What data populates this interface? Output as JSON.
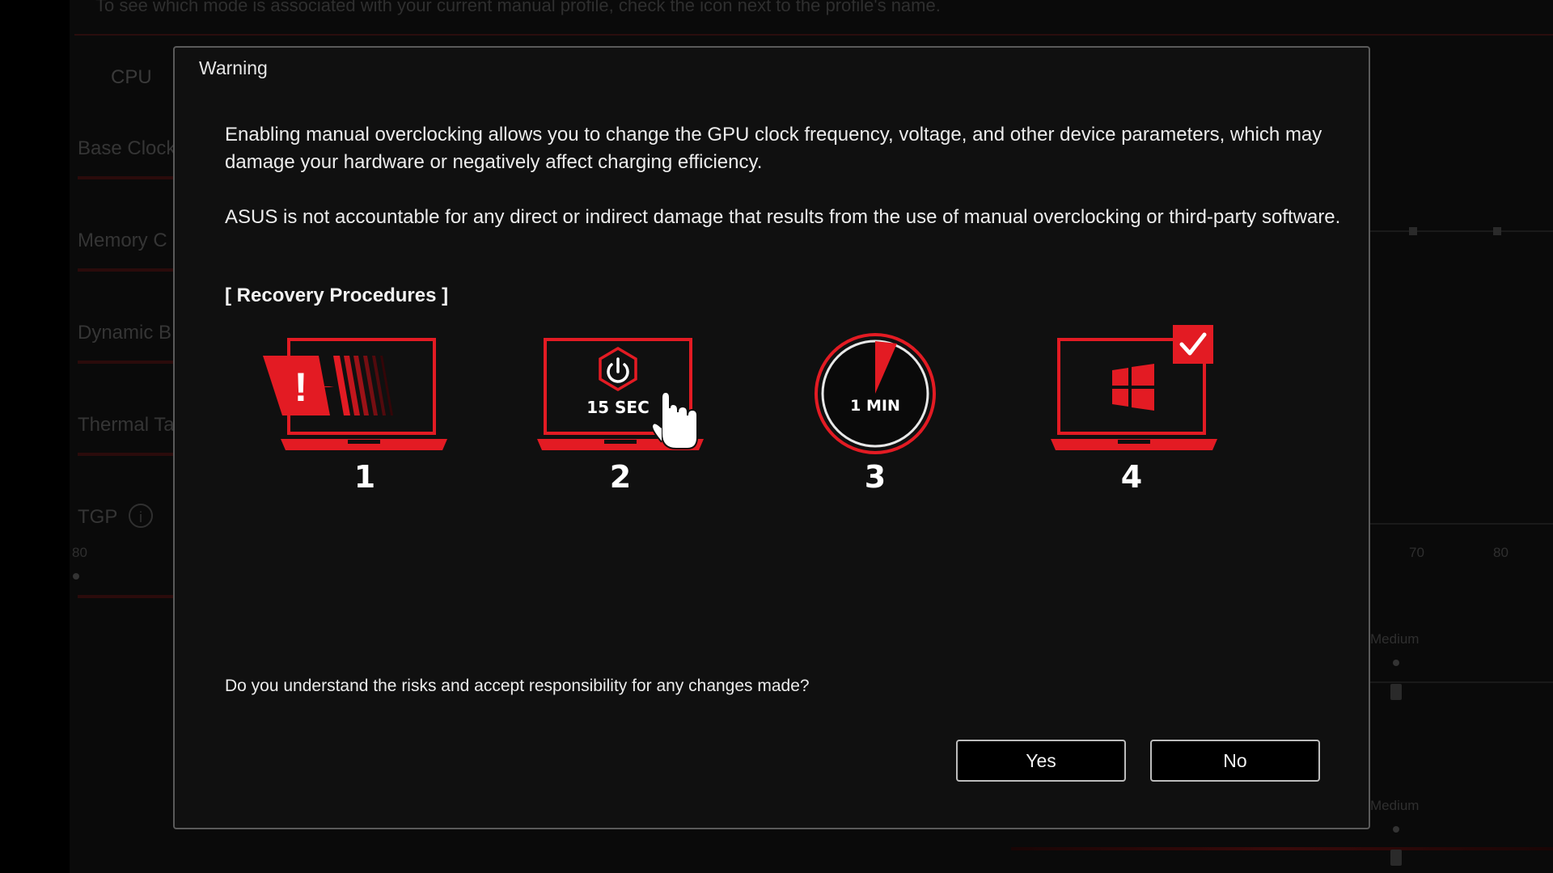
{
  "background": {
    "hint_text": "To see which mode is associated with your current manual profile, check the icon next to the profile's name.",
    "tab_cpu": "CPU",
    "labels": [
      "Base Clock",
      "Memory C",
      "Dynamic B",
      "Thermal Ta",
      "TGP"
    ],
    "tick_left": "80",
    "ticks_right": [
      "70",
      "80"
    ],
    "medium_labels": [
      "Medium",
      "Medium"
    ]
  },
  "dialog": {
    "title": "Warning",
    "paragraph1": "Enabling manual overclocking allows you to change the GPU clock frequency, voltage, and other device parameters, which may damage your hardware or negatively affect charging efficiency.",
    "paragraph2": "ASUS is not accountable for any direct or indirect damage that results from the use of manual overclocking or third-party software.",
    "recovery_title": "[ Recovery Procedures ]",
    "steps": [
      {
        "number": "1",
        "icon": "laptop-warning-icon"
      },
      {
        "number": "2",
        "icon": "laptop-power-button-icon",
        "caption": "15 SEC"
      },
      {
        "number": "3",
        "icon": "timer-icon",
        "caption": "1 MIN"
      },
      {
        "number": "4",
        "icon": "laptop-windows-check-icon"
      }
    ],
    "question": "Do you understand the risks and accept responsibility for any changes made?",
    "yes_label": "Yes",
    "no_label": "No"
  },
  "colors": {
    "accent_red": "#e31b23",
    "dialog_bg": "#101010",
    "border": "#5a5a5a"
  }
}
